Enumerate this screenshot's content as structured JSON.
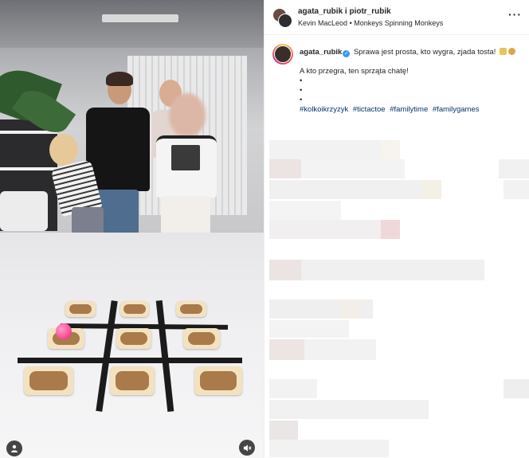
{
  "post": {
    "header": {
      "names": "agata_rubik i piotr_rubik",
      "audio_artist": "Kevin MacLeod",
      "audio_separator": "•",
      "audio_title": "Monkeys Spinning Monkeys",
      "more_label": "···"
    },
    "caption": {
      "username": "agata_rubik",
      "verified_label": "✓",
      "text": "Sprawa jest prosta, kto wygra, zjada tosta!",
      "line2": "A kto przegra, ten sprząta chatę!",
      "bullets": [
        "•",
        "•",
        "•"
      ],
      "hashtags": [
        "#kolkoikrzyzyk",
        "#tictactoe",
        "#familytime",
        "#familygames"
      ]
    }
  },
  "colors": {
    "hashtag": "#00376b",
    "verified": "#3897f0",
    "ball": "#ff4f9a"
  },
  "icons": {
    "user_tag": "person-icon",
    "mute": "speaker-muted-icon"
  }
}
